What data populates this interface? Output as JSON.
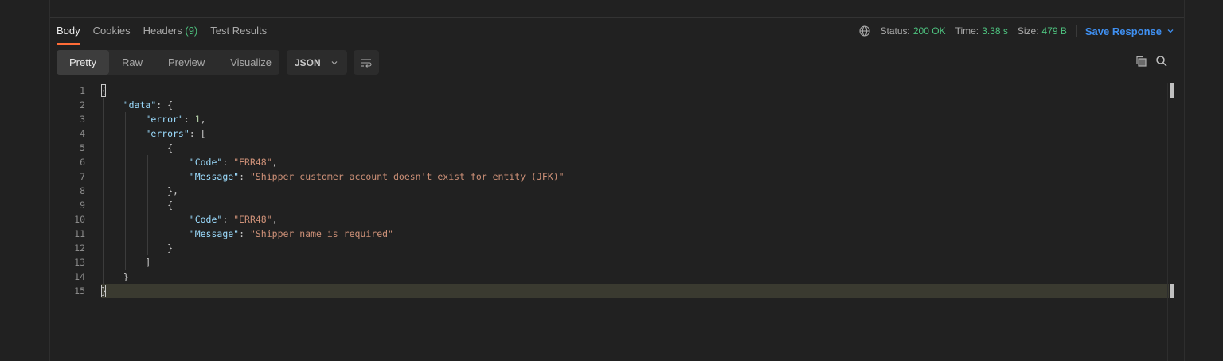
{
  "tabs": [
    {
      "label": "Body",
      "count": ""
    },
    {
      "label": "Cookies",
      "count": ""
    },
    {
      "label": "Headers",
      "count": "(9)"
    },
    {
      "label": "Test Results",
      "count": ""
    }
  ],
  "status": {
    "status_label": "Status:",
    "status_value": "200 OK",
    "time_label": "Time:",
    "time_value": "3.38 s",
    "size_label": "Size:",
    "size_value": "479 B",
    "save_label": "Save Response"
  },
  "view_modes": [
    "Pretty",
    "Raw",
    "Preview",
    "Visualize"
  ],
  "format": "JSON",
  "icons": {
    "globe": "globe-icon",
    "copy": "copy-icon",
    "search": "search-icon",
    "wrap": "wrap-lines-icon"
  },
  "colors": {
    "accent": "#ff6c37",
    "success": "#4ec27f",
    "link": "#3f8ff0",
    "key": "#9cdcfe",
    "string": "#ce9178",
    "number": "#b5cea8"
  },
  "code_lines": [
    {
      "n": "1",
      "tokens": [
        {
          "t": "{",
          "c": "p"
        }
      ]
    },
    {
      "n": "2",
      "tokens": [
        {
          "t": "    ",
          "c": "p"
        },
        {
          "t": "\"data\"",
          "c": "k"
        },
        {
          "t": ": {",
          "c": "p"
        }
      ]
    },
    {
      "n": "3",
      "tokens": [
        {
          "t": "        ",
          "c": "p"
        },
        {
          "t": "\"error\"",
          "c": "k"
        },
        {
          "t": ": ",
          "c": "p"
        },
        {
          "t": "1",
          "c": "n"
        },
        {
          "t": ",",
          "c": "p"
        }
      ]
    },
    {
      "n": "4",
      "tokens": [
        {
          "t": "        ",
          "c": "p"
        },
        {
          "t": "\"errors\"",
          "c": "k"
        },
        {
          "t": ": [",
          "c": "p"
        }
      ]
    },
    {
      "n": "5",
      "tokens": [
        {
          "t": "            {",
          "c": "p"
        }
      ]
    },
    {
      "n": "6",
      "tokens": [
        {
          "t": "                ",
          "c": "p"
        },
        {
          "t": "\"Code\"",
          "c": "k"
        },
        {
          "t": ": ",
          "c": "p"
        },
        {
          "t": "\"ERR48\"",
          "c": "s"
        },
        {
          "t": ",",
          "c": "p"
        }
      ]
    },
    {
      "n": "7",
      "tokens": [
        {
          "t": "                ",
          "c": "p"
        },
        {
          "t": "\"Message\"",
          "c": "k"
        },
        {
          "t": ": ",
          "c": "p"
        },
        {
          "t": "\"Shipper customer account doesn't exist for entity (JFK)\"",
          "c": "s"
        }
      ]
    },
    {
      "n": "8",
      "tokens": [
        {
          "t": "            },",
          "c": "p"
        }
      ]
    },
    {
      "n": "9",
      "tokens": [
        {
          "t": "            {",
          "c": "p"
        }
      ]
    },
    {
      "n": "10",
      "tokens": [
        {
          "t": "                ",
          "c": "p"
        },
        {
          "t": "\"Code\"",
          "c": "k"
        },
        {
          "t": ": ",
          "c": "p"
        },
        {
          "t": "\"ERR48\"",
          "c": "s"
        },
        {
          "t": ",",
          "c": "p"
        }
      ]
    },
    {
      "n": "11",
      "tokens": [
        {
          "t": "                ",
          "c": "p"
        },
        {
          "t": "\"Message\"",
          "c": "k"
        },
        {
          "t": ": ",
          "c": "p"
        },
        {
          "t": "\"Shipper name is required\"",
          "c": "s"
        }
      ]
    },
    {
      "n": "12",
      "tokens": [
        {
          "t": "            }",
          "c": "p"
        }
      ]
    },
    {
      "n": "13",
      "tokens": [
        {
          "t": "        ]",
          "c": "p"
        }
      ]
    },
    {
      "n": "14",
      "tokens": [
        {
          "t": "    }",
          "c": "p"
        }
      ]
    },
    {
      "n": "15",
      "tokens": [
        {
          "t": "}",
          "c": "p"
        }
      ]
    }
  ]
}
